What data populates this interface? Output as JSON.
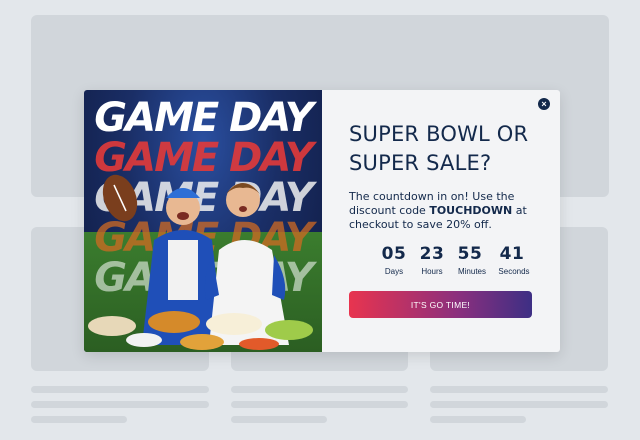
{
  "modal": {
    "hero_lines": [
      "GAME DAY",
      "GAME DAY",
      "GAME DAY",
      "GAME DAY",
      "GAME DAY"
    ],
    "title_line1": "SUPER BOWL OR",
    "title_line2": "SUPER SALE?",
    "desc_prefix": "The countdown in on! Use the discount code ",
    "desc_code": "TOUCHDOWN",
    "desc_suffix": " at checkout to save 20% off.",
    "countdown": [
      {
        "value": "05",
        "label": "Days"
      },
      {
        "value": "23",
        "label": "Hours"
      },
      {
        "value": "55",
        "label": "Minutes"
      },
      {
        "value": "41",
        "label": "Seconds"
      }
    ],
    "cta_label": "IT'S GO TIME!",
    "close_icon": "×"
  },
  "colors": {
    "navy": "#13294b",
    "cta_start": "#e8344f",
    "cta_end": "#3d2f84",
    "backdrop": "#e3e7eb"
  },
  "icons": [
    "close-icon",
    "football-icon"
  ]
}
